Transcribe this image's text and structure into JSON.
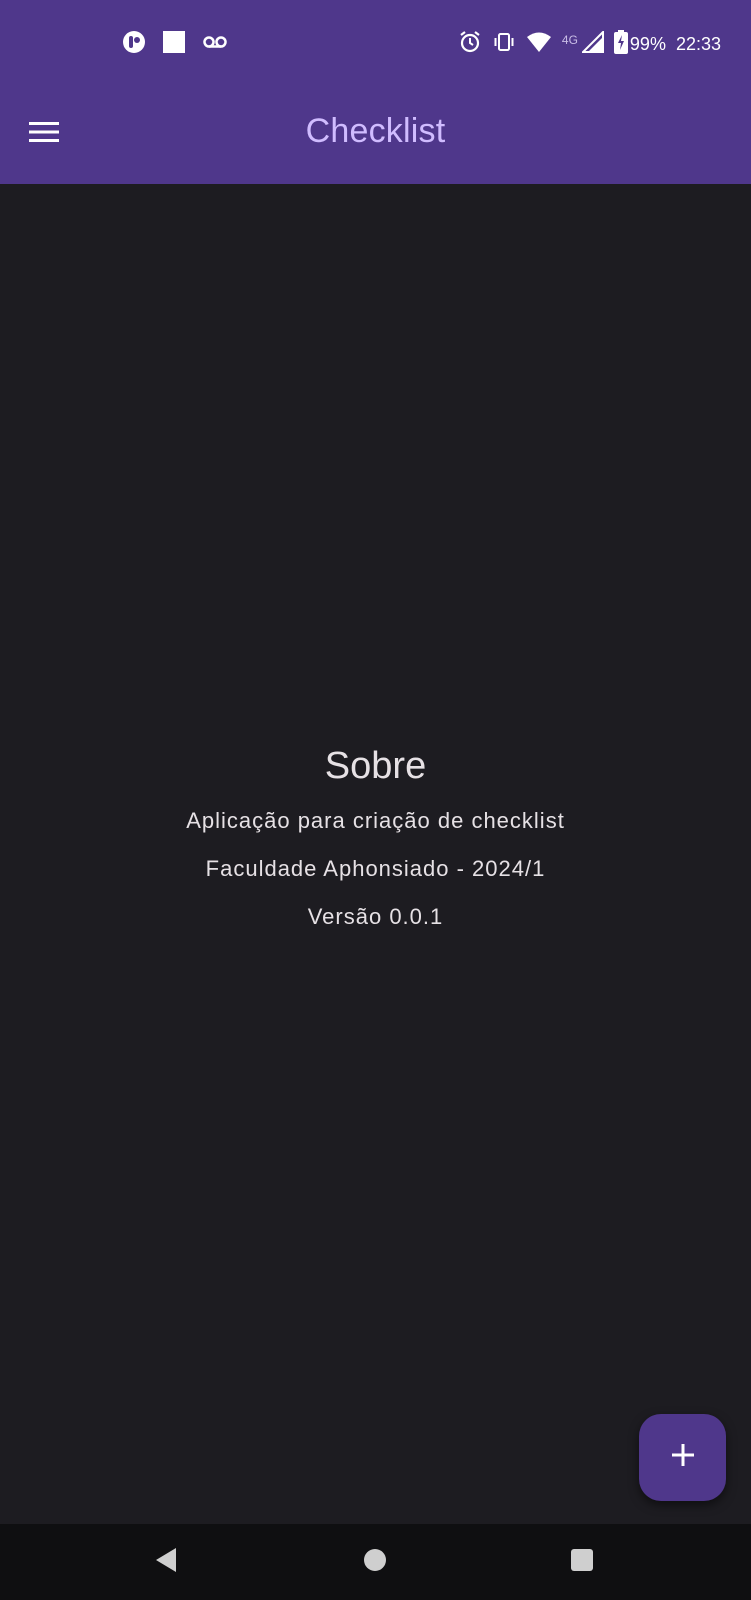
{
  "status_bar": {
    "left_icons": [
      "app-notification-icon",
      "square-notification-icon",
      "voicemail-icon"
    ],
    "right_icons": [
      "alarm-icon",
      "vibrate-icon",
      "wifi-icon",
      "cellular-signal-icon",
      "battery-charging-icon"
    ],
    "network_type": "4G",
    "battery": "99%",
    "time": "22:33"
  },
  "app_bar": {
    "title": "Checklist",
    "menu_icon": "hamburger-menu-icon"
  },
  "about": {
    "title": "Sobre",
    "description": "Aplicação para criação de checklist",
    "institution": "Faculdade Aphonsiado - 2024/1",
    "version": "Versão 0.0.1"
  },
  "fab": {
    "icon": "plus-icon"
  },
  "nav_bar": {
    "icons": [
      "back-icon",
      "home-icon",
      "recents-icon"
    ]
  },
  "colors": {
    "primary": "#4f378b",
    "title_text": "#d0bcff",
    "background": "#1d1c21",
    "body_text": "#e6e1e5"
  }
}
